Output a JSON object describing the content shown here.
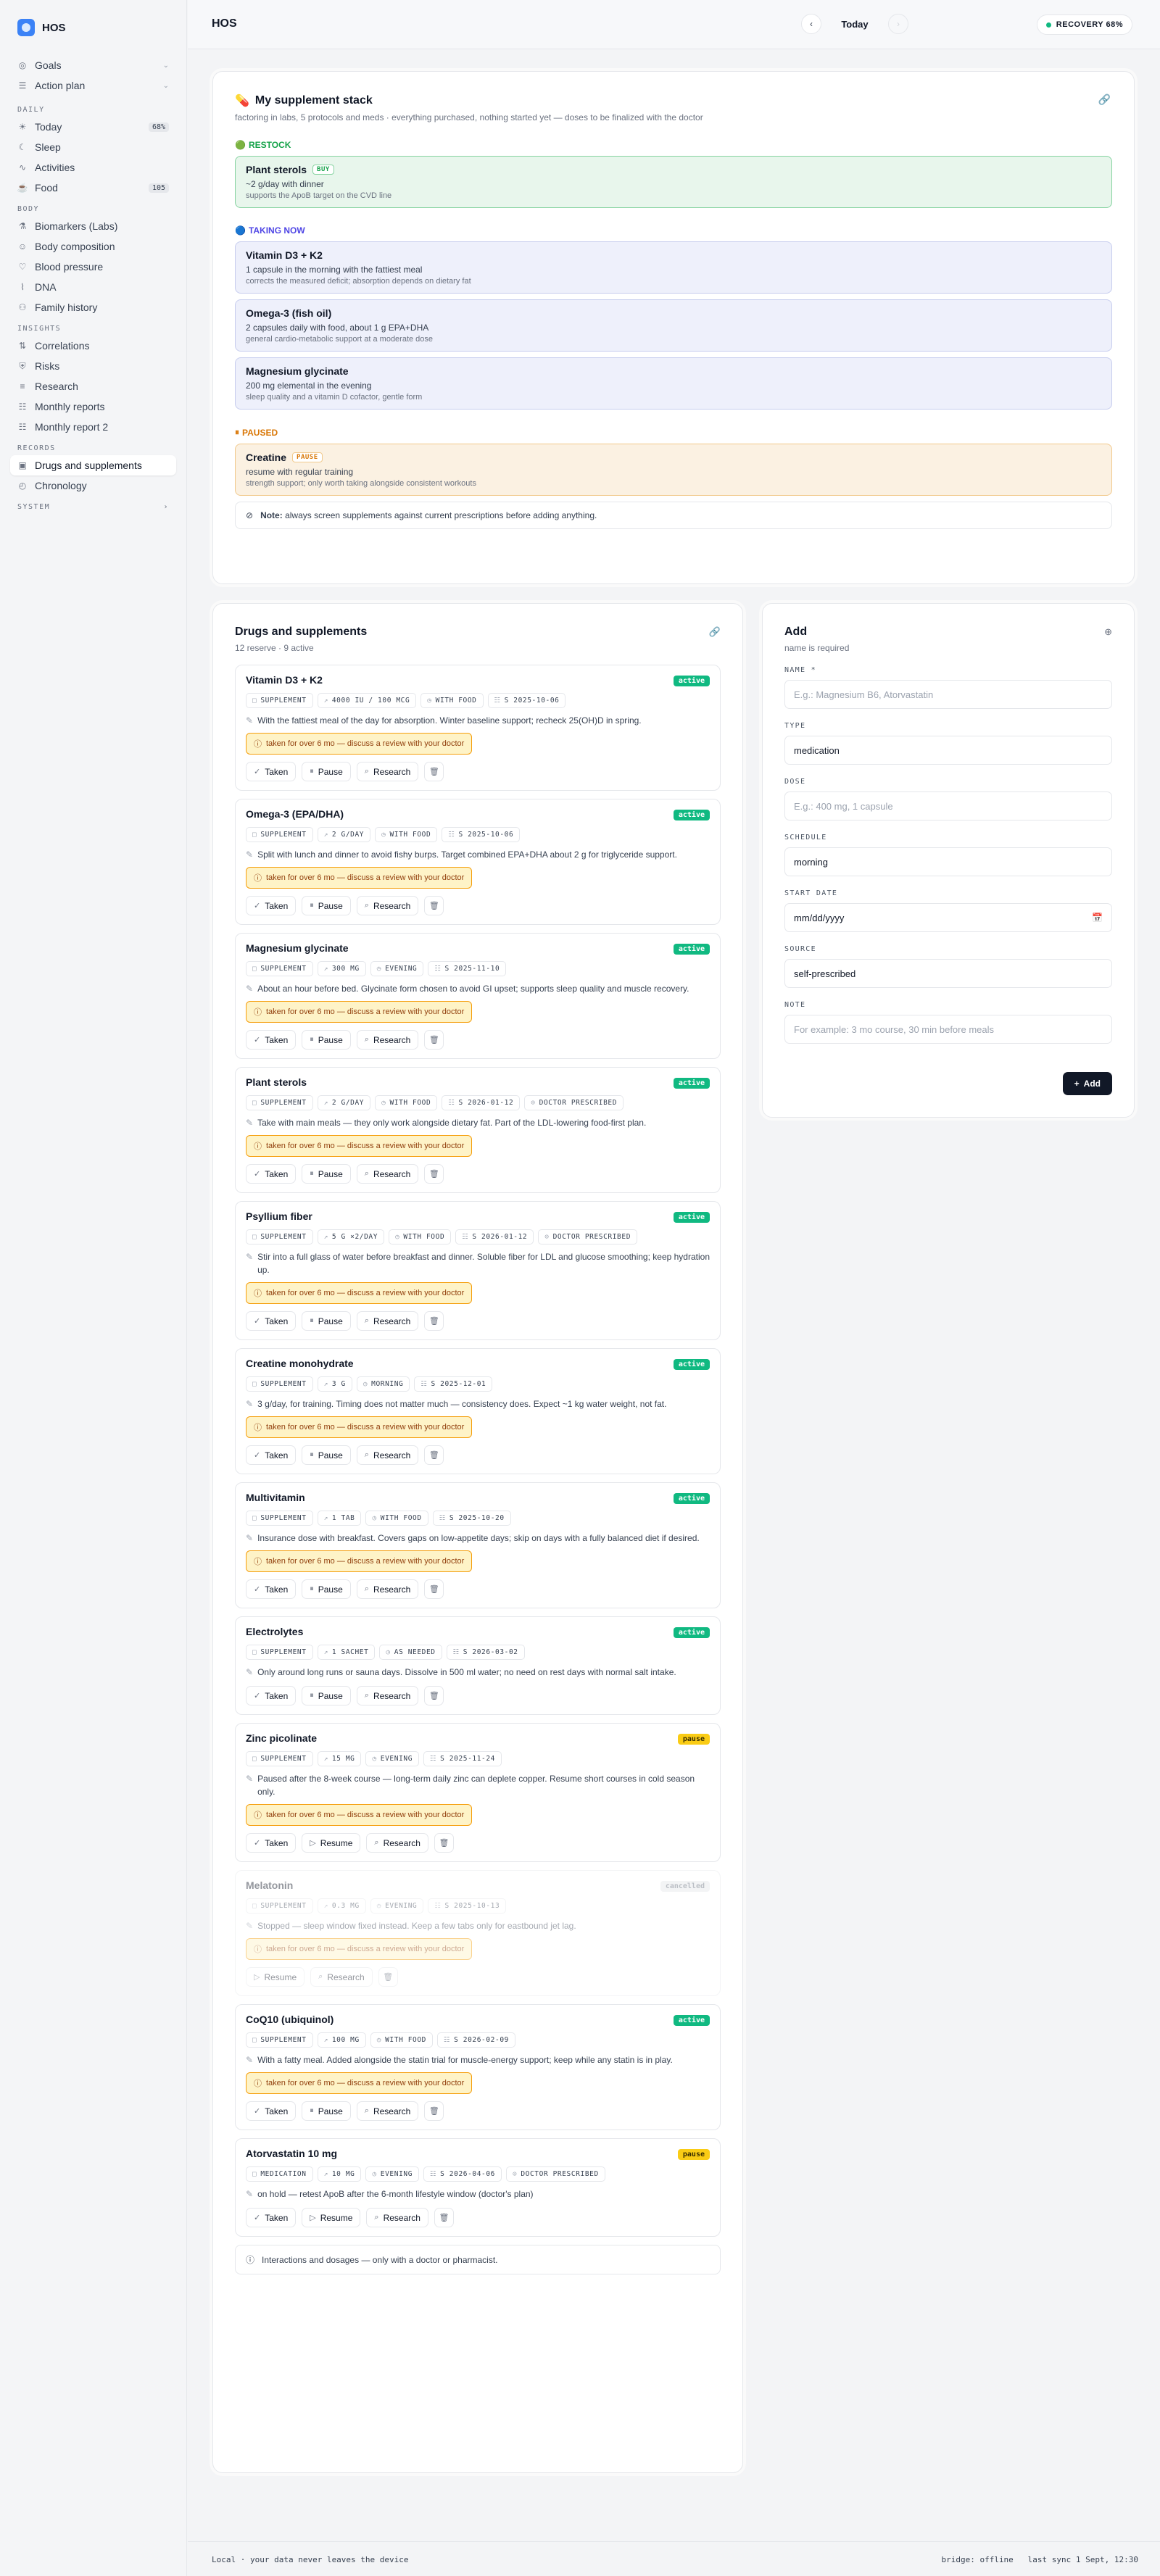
{
  "app": {
    "name": "HOS"
  },
  "sidebar": {
    "top": [
      {
        "label": "Goals",
        "icon": "target-icon"
      },
      {
        "label": "Action plan",
        "icon": "list-icon"
      }
    ],
    "sections": [
      {
        "title": "DAILY",
        "items": [
          {
            "label": "Today",
            "badge": "68%",
            "icon": "sun-icon"
          },
          {
            "label": "Sleep",
            "icon": "moon-icon"
          },
          {
            "label": "Activities",
            "icon": "activity-icon"
          },
          {
            "label": "Food",
            "badge": "105",
            "icon": "food-icon"
          }
        ]
      },
      {
        "title": "BODY",
        "items": [
          {
            "label": "Biomarkers (Labs)",
            "icon": "flask-icon"
          },
          {
            "label": "Body composition",
            "icon": "body-icon"
          },
          {
            "label": "Blood pressure",
            "icon": "heart-icon"
          },
          {
            "label": "DNA",
            "icon": "dna-icon"
          },
          {
            "label": "Family history",
            "icon": "family-icon"
          }
        ]
      },
      {
        "title": "INSIGHTS",
        "items": [
          {
            "label": "Correlations",
            "icon": "chart-icon"
          },
          {
            "label": "Risks",
            "icon": "shield-icon"
          },
          {
            "label": "Research",
            "icon": "book-icon"
          },
          {
            "label": "Monthly reports",
            "icon": "report-icon"
          },
          {
            "label": "Monthly report 2",
            "icon": "report-icon"
          }
        ]
      },
      {
        "title": "RECORDS",
        "items": [
          {
            "label": "Drugs and supplements",
            "icon": "pill-icon",
            "active": true
          },
          {
            "label": "Chronology",
            "icon": "clock-icon"
          }
        ]
      }
    ],
    "system": "SYSTEM"
  },
  "topbar": {
    "title": "HOS",
    "date_label": "Today",
    "recovery": "RECOVERY 68%"
  },
  "stack": {
    "title": "My supplement stack",
    "subtitle": "factoring in labs, 5 protocols and meds · everything purchased, nothing started yet — doses to be finalized with the doctor",
    "groups": [
      {
        "label": "RESTOCK",
        "color": "g",
        "items": [
          {
            "name": "Plant sterols",
            "tag": "BUY",
            "dose": "~2 g/day with dinner",
            "why": "supports the ApoB target on the CVD line",
            "style": "green"
          }
        ]
      },
      {
        "label": "TAKING NOW",
        "color": "b",
        "items": [
          {
            "name": "Vitamin D3 + K2",
            "dose": "1 capsule in the morning with the fattiest meal",
            "why": "corrects the measured deficit; absorption depends on dietary fat",
            "style": "blue"
          },
          {
            "name": "Omega-3 (fish oil)",
            "dose": "2 capsules daily with food, about 1 g EPA+DHA",
            "why": "general cardio-metabolic support at a moderate dose",
            "style": "blue"
          },
          {
            "name": "Magnesium glycinate",
            "dose": "200 mg elemental in the evening",
            "why": "sleep quality and a vitamin D cofactor, gentle form",
            "style": "blue"
          }
        ]
      },
      {
        "label": "PAUSED",
        "color": "o",
        "items": [
          {
            "name": "Creatine",
            "tag": "PAUSE",
            "dose": "resume with regular training",
            "why": "strength support; only worth taking alongside consistent workouts",
            "style": "orange"
          }
        ]
      }
    ],
    "note_bold": "Note:",
    "note_text": "always screen supplements against current prescriptions before adding anything."
  },
  "drugs": {
    "title": "Drugs and supplements",
    "subtitle": "12 reserve · 9 active",
    "warning": "taken for over 6 mo — discuss a review with your doctor",
    "buttons": {
      "taken": "Taken",
      "pause": "Pause",
      "resume": "Resume",
      "research": "Research"
    },
    "items": [
      {
        "name": "Vitamin D3 + K2",
        "status": "active",
        "chips": [
          "SUPPLEMENT",
          "4000 IU / 100 MCG",
          "WITH FOOD",
          "S 2025-10-06"
        ],
        "desc": "With the fattiest meal of the day for absorption. Winter baseline support; recheck 25(OH)D in spring.",
        "warn": true,
        "acts": [
          "taken",
          "pause",
          "research"
        ]
      },
      {
        "name": "Omega-3 (EPA/DHA)",
        "status": "active",
        "chips": [
          "SUPPLEMENT",
          "2 G/DAY",
          "WITH FOOD",
          "S 2025-10-06"
        ],
        "desc": "Split with lunch and dinner to avoid fishy burps. Target combined EPA+DHA about 2 g for triglyceride support.",
        "warn": true,
        "acts": [
          "taken",
          "pause",
          "research"
        ]
      },
      {
        "name": "Magnesium glycinate",
        "status": "active",
        "chips": [
          "SUPPLEMENT",
          "300 MG",
          "EVENING",
          "S 2025-11-10"
        ],
        "desc": "About an hour before bed. Glycinate form chosen to avoid GI upset; supports sleep quality and muscle recovery.",
        "warn": true,
        "acts": [
          "taken",
          "pause",
          "research"
        ]
      },
      {
        "name": "Plant sterols",
        "status": "active",
        "chips": [
          "SUPPLEMENT",
          "2 G/DAY",
          "WITH FOOD",
          "S 2026-01-12",
          "DOCTOR PRESCRIBED"
        ],
        "desc": "Take with main meals — they only work alongside dietary fat. Part of the LDL-lowering food-first plan.",
        "warn": true,
        "acts": [
          "taken",
          "pause",
          "research"
        ]
      },
      {
        "name": "Psyllium fiber",
        "status": "active",
        "chips": [
          "SUPPLEMENT",
          "5 G ×2/DAY",
          "WITH FOOD",
          "S 2026-01-12",
          "DOCTOR PRESCRIBED"
        ],
        "desc": "Stir into a full glass of water before breakfast and dinner. Soluble fiber for LDL and glucose smoothing; keep hydration up.",
        "warn": true,
        "acts": [
          "taken",
          "pause",
          "research"
        ]
      },
      {
        "name": "Creatine monohydrate",
        "status": "active",
        "chips": [
          "SUPPLEMENT",
          "3 G",
          "MORNING",
          "S 2025-12-01"
        ],
        "desc": "3 g/day, for training. Timing does not matter much — consistency does. Expect ~1 kg water weight, not fat.",
        "warn": true,
        "acts": [
          "taken",
          "pause",
          "research"
        ]
      },
      {
        "name": "Multivitamin",
        "status": "active",
        "chips": [
          "SUPPLEMENT",
          "1 TAB",
          "WITH FOOD",
          "S 2025-10-20"
        ],
        "desc": "Insurance dose with breakfast. Covers gaps on low-appetite days; skip on days with a fully balanced diet if desired.",
        "warn": true,
        "acts": [
          "taken",
          "pause",
          "research"
        ]
      },
      {
        "name": "Electrolytes",
        "status": "active",
        "chips": [
          "SUPPLEMENT",
          "1 SACHET",
          "AS NEEDED",
          "S 2026-03-02"
        ],
        "desc": "Only around long runs or sauna days. Dissolve in 500 ml water; no need on rest days with normal salt intake.",
        "warn": false,
        "acts": [
          "taken",
          "pause",
          "research"
        ]
      },
      {
        "name": "Zinc picolinate",
        "status": "pause",
        "chips": [
          "SUPPLEMENT",
          "15 MG",
          "EVENING",
          "S 2025-11-24"
        ],
        "desc": "Paused after the 8-week course — long-term daily zinc can deplete copper. Resume short courses in cold season only.",
        "warn": true,
        "acts": [
          "taken",
          "resume",
          "research"
        ]
      },
      {
        "name": "Melatonin",
        "status": "cancelled",
        "faded": true,
        "chips": [
          "SUPPLEMENT",
          "0.3 MG",
          "EVENING",
          "S 2025-10-13"
        ],
        "desc": "Stopped — sleep window fixed instead. Keep a few tabs only for eastbound jet lag.",
        "warn": true,
        "acts": [
          "resume",
          "research"
        ]
      },
      {
        "name": "CoQ10 (ubiquinol)",
        "status": "active",
        "chips": [
          "SUPPLEMENT",
          "100 MG",
          "WITH FOOD",
          "S 2026-02-09"
        ],
        "desc": "With a fatty meal. Added alongside the statin trial for muscle-energy support; keep while any statin is in play.",
        "warn": true,
        "acts": [
          "taken",
          "pause",
          "research"
        ]
      },
      {
        "name": "Atorvastatin 10 mg",
        "status": "pause",
        "chips": [
          "MEDICATION",
          "10 MG",
          "EVENING",
          "S 2026-04-06",
          "DOCTOR PRESCRIBED"
        ],
        "desc": "on hold — retest ApoB after the 6-month lifestyle window (doctor's plan)",
        "warn": false,
        "acts": [
          "taken",
          "resume",
          "research"
        ]
      }
    ],
    "footer": "Interactions and dosages — only with a doctor or pharmacist."
  },
  "add": {
    "title": "Add",
    "subtitle": "name is required",
    "fields": {
      "name_label": "NAME *",
      "name_placeholder": "E.g.: Magnesium B6, Atorvastatin",
      "type_label": "TYPE",
      "type_value": "medication",
      "dose_label": "DOSE",
      "dose_placeholder": "E.g.: 400 mg, 1 capsule",
      "schedule_label": "SCHEDULE",
      "schedule_value": "morning",
      "start_label": "START DATE",
      "start_placeholder": "mm/dd/yyyy",
      "source_label": "SOURCE",
      "source_value": "self-prescribed",
      "note_label": "NOTE",
      "note_placeholder": "For example: 3 mo course, 30 min before meals"
    },
    "submit": "Add"
  },
  "footer": {
    "left": "Local · your data never leaves the device",
    "right": "bridge: offline   last sync 1 Sept, 12:30"
  }
}
